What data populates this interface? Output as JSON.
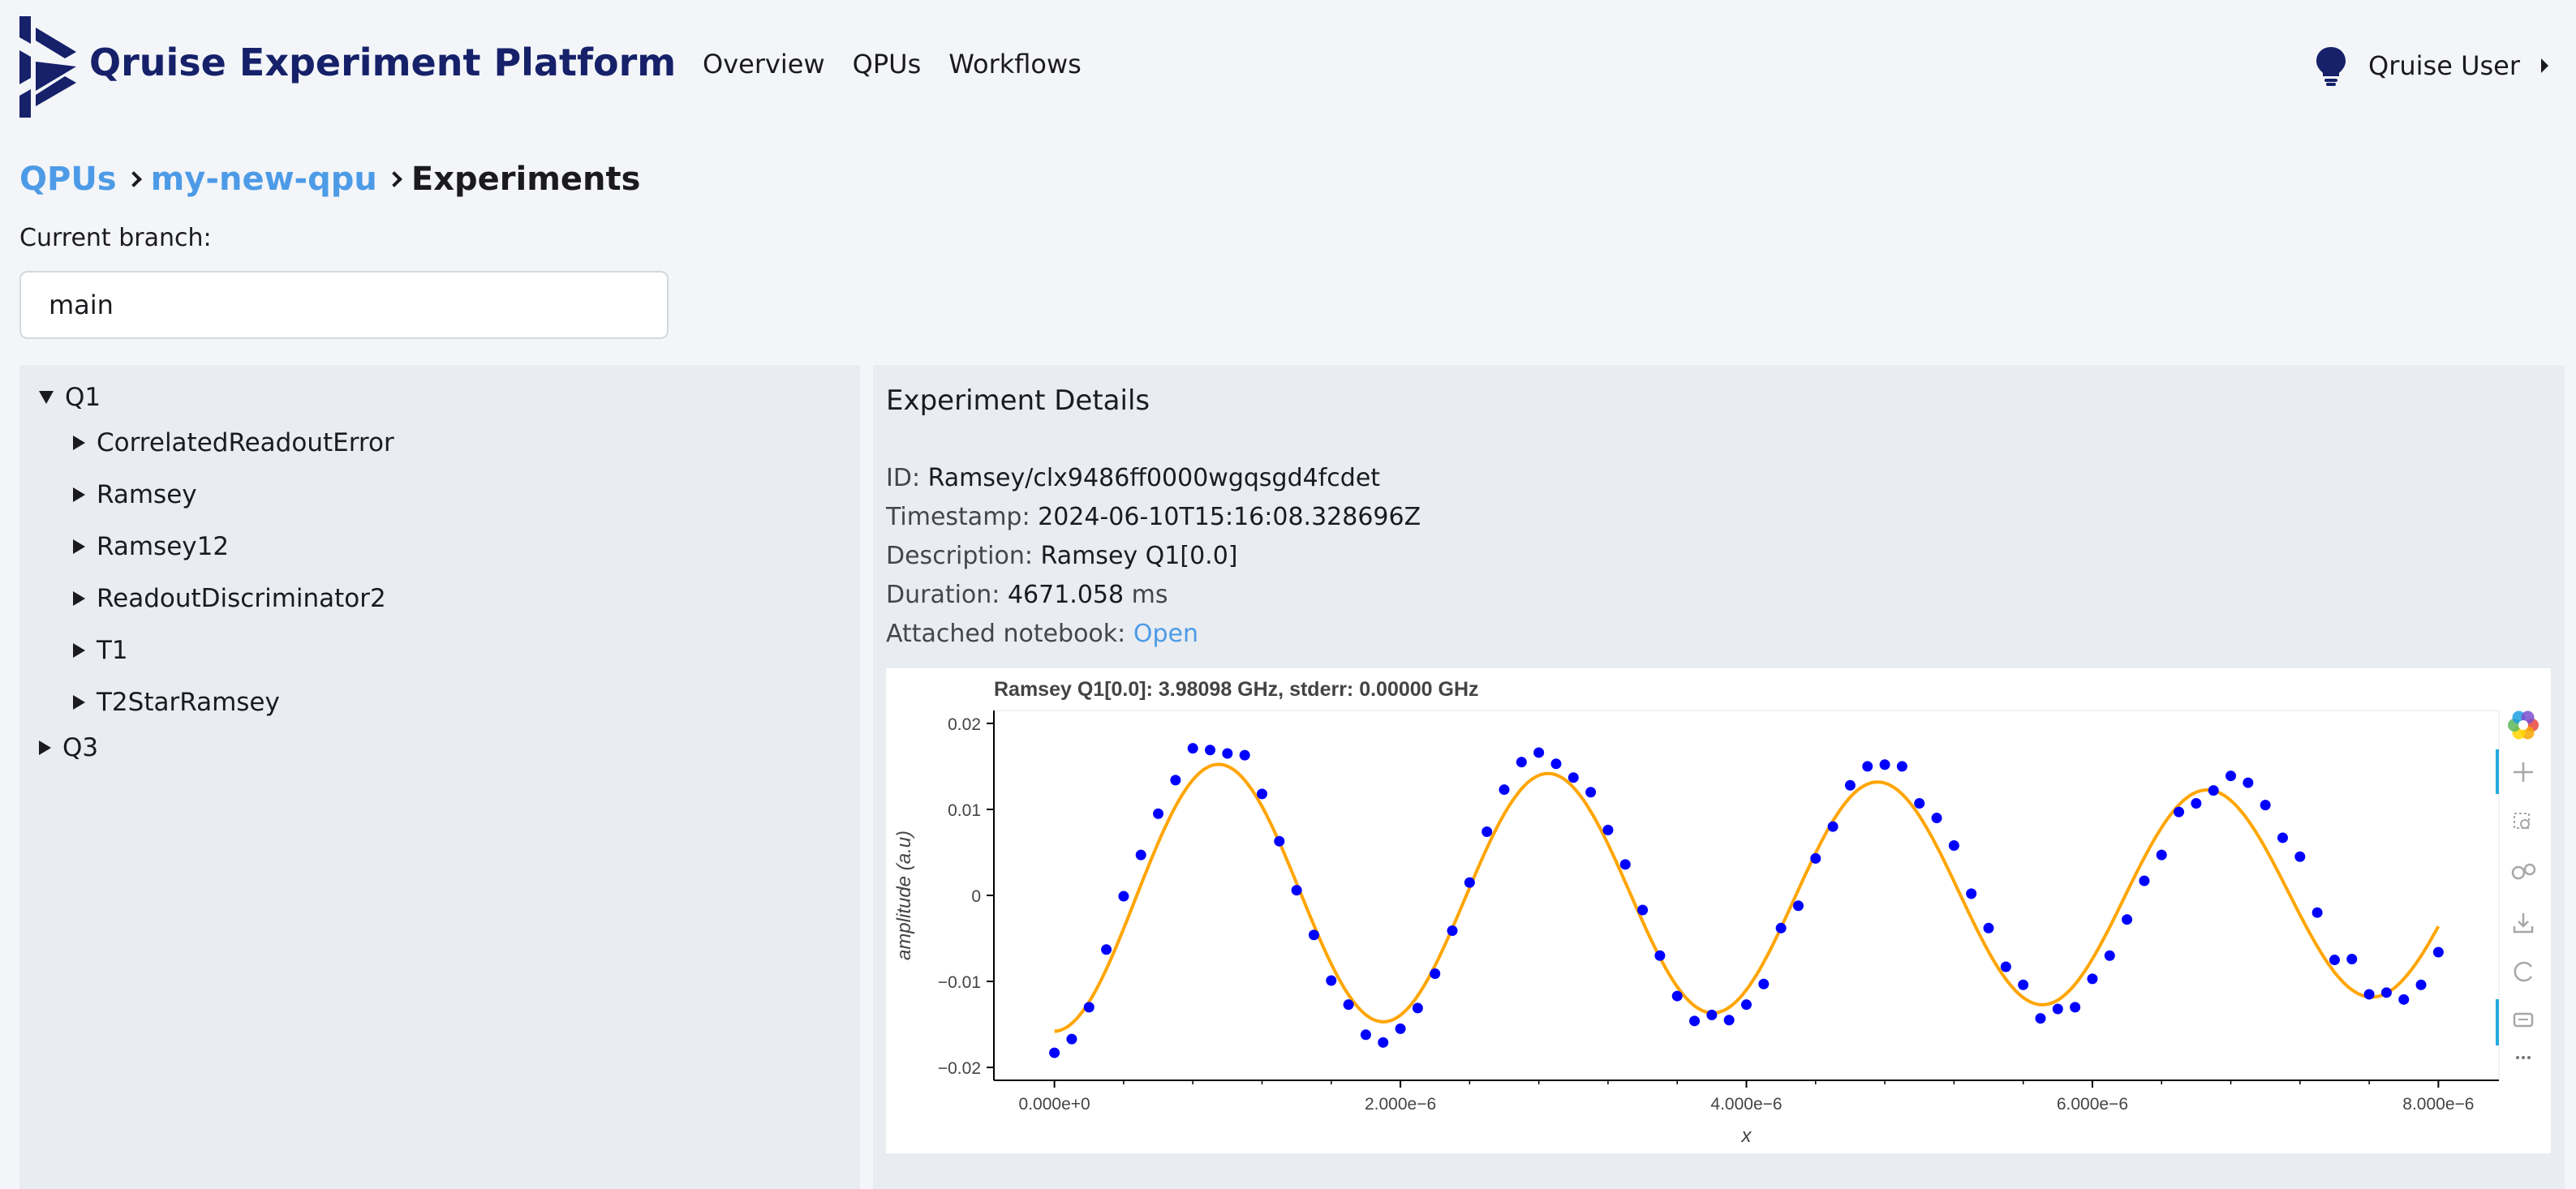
{
  "app": {
    "title": "Qruise Experiment Platform"
  },
  "nav": [
    {
      "label": "Overview"
    },
    {
      "label": "QPUs"
    },
    {
      "label": "Workflows"
    }
  ],
  "user": {
    "name": "Qruise User"
  },
  "breadcrumb": {
    "qpus": "QPUs",
    "qpu": "my-new-qpu",
    "current": "Experiments"
  },
  "branch": {
    "label": "Current branch:",
    "value": "main"
  },
  "tree": {
    "groups": [
      {
        "label": "Q1",
        "expanded": true,
        "children": [
          "CorrelatedReadoutError",
          "Ramsey",
          "Ramsey12",
          "ReadoutDiscriminator2",
          "T1",
          "T2StarRamsey"
        ]
      },
      {
        "label": "Q3",
        "expanded": false,
        "children": []
      }
    ]
  },
  "details": {
    "title": "Experiment Details",
    "id_label": "ID:",
    "id": "Ramsey/clx9486ff0000wgqsgd4fcdet",
    "timestamp_label": "Timestamp:",
    "timestamp": "2024-06-10T15:16:08.328696Z",
    "description_label": "Description:",
    "description": "Ramsey Q1[0.0]",
    "duration_label": "Duration:",
    "duration_value": "4671.058",
    "duration_unit": "ms",
    "notebook_label": "Attached notebook:",
    "notebook_link": "Open"
  },
  "colors": {
    "brand": "#16216a",
    "link": "#4d9be6",
    "fit": "#ffa500",
    "points": "#0000ff"
  },
  "chart_data": {
    "type": "scatter",
    "title": "Ramsey Q1[0.0]: 3.98098 GHz, stderr: 0.00000 GHz",
    "xlabel": "x",
    "ylabel": "amplitude (a.u)",
    "xlim": [
      -3.5e-07,
      8.35e-06
    ],
    "ylim": [
      -0.0215,
      0.0215
    ],
    "x_ticks": [
      0,
      2e-06,
      4e-06,
      6e-06,
      8e-06
    ],
    "x_tick_labels": [
      "0.000e+0",
      "2.000e−6",
      "4.000e−6",
      "6.000e−6",
      "8.000e−6"
    ],
    "y_ticks": [
      0.02,
      0.01,
      0,
      -0.01,
      -0.02
    ],
    "y_tick_labels": [
      "0.02",
      "0.01",
      "0",
      "−0.01",
      "−0.02"
    ],
    "series": [
      {
        "kind": "points",
        "x": [
          0,
          1e-07,
          2e-07,
          3e-07,
          4e-07,
          5e-07,
          6e-07,
          7e-07,
          8e-07,
          9e-07,
          1e-06,
          1.1e-06,
          1.2e-06,
          1.3e-06,
          1.4e-06,
          1.5e-06,
          1.6e-06,
          1.7e-06,
          1.8e-06,
          1.9e-06,
          2e-06,
          2.1e-06,
          2.2e-06,
          2.3e-06,
          2.4e-06,
          2.5e-06,
          2.6e-06,
          2.7e-06,
          2.8e-06,
          2.9e-06,
          3e-06,
          3.1e-06,
          3.2e-06,
          3.3e-06,
          3.4e-06,
          3.5e-06,
          3.6e-06,
          3.7e-06,
          3.8e-06,
          3.9e-06,
          4e-06,
          4.1e-06,
          4.2e-06,
          4.3e-06,
          4.4e-06,
          4.5e-06,
          4.6e-06,
          4.7e-06,
          4.8e-06,
          4.9e-06,
          5e-06,
          5.1e-06,
          5.2e-06,
          5.3e-06,
          5.4e-06,
          5.5e-06,
          5.6e-06,
          5.7e-06,
          5.8e-06,
          5.9e-06,
          6e-06,
          6.1e-06,
          6.2e-06,
          6.3e-06,
          6.4e-06,
          6.5e-06,
          6.6e-06,
          6.7e-06,
          6.8e-06,
          6.9e-06,
          7e-06,
          7.1e-06,
          7.2e-06,
          7.3e-06,
          7.4e-06,
          7.5e-06,
          7.6e-06,
          7.7e-06,
          7.8e-06,
          7.9e-06,
          8e-06
        ],
        "y": [
          -0.0183,
          -0.0167,
          -0.013,
          -0.0063,
          -0.0001,
          0.0047,
          0.0095,
          0.0134,
          0.0171,
          0.0169,
          0.0165,
          0.0163,
          0.0118,
          0.0063,
          0.0006,
          -0.0046,
          -0.0099,
          -0.0127,
          -0.0162,
          -0.0171,
          -0.0155,
          -0.0131,
          -0.0091,
          -0.0041,
          0.0015,
          0.0074,
          0.0123,
          0.0155,
          0.0166,
          0.0153,
          0.0137,
          0.012,
          0.0076,
          0.0036,
          -0.0017,
          -0.007,
          -0.0117,
          -0.0146,
          -0.0139,
          -0.0145,
          -0.0127,
          -0.0103,
          -0.0038,
          -0.0012,
          0.0043,
          0.008,
          0.0128,
          0.015,
          0.0152,
          0.015,
          0.0107,
          0.009,
          0.0058,
          0.0002,
          -0.0038,
          -0.0083,
          -0.0104,
          -0.0143,
          -0.0132,
          -0.013,
          -0.0097,
          -0.007,
          -0.0028,
          0.0017,
          0.0047,
          0.0097,
          0.0107,
          0.0122,
          0.0139,
          0.0131,
          0.0105,
          0.0067,
          0.0045,
          -0.002,
          -0.0075,
          -0.0074,
          -0.0115,
          -0.0113,
          -0.0121,
          -0.0104,
          -0.0066
        ]
      },
      {
        "kind": "fit",
        "amplitude": 0.0158,
        "decay_per_s": 38000,
        "frequency_hz": 525000,
        "offset": 0.0,
        "phase": 3.1416
      }
    ]
  }
}
